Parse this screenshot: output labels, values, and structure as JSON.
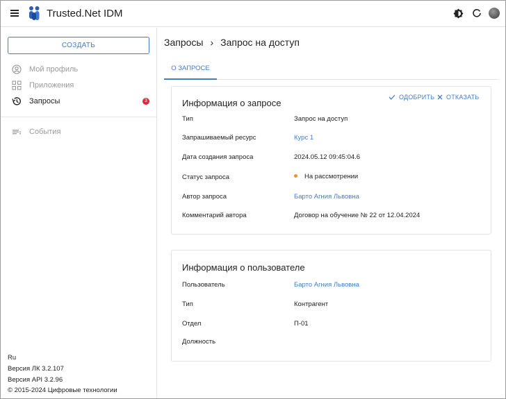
{
  "header": {
    "app_title": "Trusted.Net IDM"
  },
  "sidebar": {
    "create_label": "СОЗДАТЬ",
    "items": [
      {
        "label": "Мой профиль",
        "icon": "account-circle-icon"
      },
      {
        "label": "Приложения",
        "icon": "apps-grid-icon"
      },
      {
        "label": "Запросы",
        "icon": "history-icon",
        "badge": "3"
      },
      {
        "label": "События",
        "icon": "events-list-icon"
      }
    ],
    "footer": {
      "lang": "Ru",
      "lk_version": "Версия ЛК 3.2.107",
      "api_version": "Версия API 3.2.96",
      "copyright": "© 2015-2024 Цифровые технологии"
    }
  },
  "breadcrumb": {
    "root": "Запросы",
    "current": "Запрос на доступ"
  },
  "tabs": {
    "about": "О ЗАПРОСЕ"
  },
  "request_card": {
    "title": "Информация о запросе",
    "approve_label": "ОДОБРИТЬ",
    "reject_label": "ОТКАЗАТЬ",
    "rows": [
      {
        "label": "Тип",
        "value": "Запрос на доступ"
      },
      {
        "label": "Запрашиваемый ресурс",
        "value": "Курс 1"
      },
      {
        "label": "Дата создания запроса",
        "value": "2024.05.12 09:45:04.6"
      },
      {
        "label": "Статус запроса",
        "value": "На рассмотрении"
      },
      {
        "label": "Автор запроса",
        "value": "Барто Агния Львовна"
      },
      {
        "label": "Комментарий автора",
        "value": "Договор на обучение № 22 от 12.04.2024"
      }
    ]
  },
  "user_card": {
    "title": "Информация о пользователе",
    "rows": [
      {
        "label": "Пользователь",
        "value": "Барто Агния Львовна"
      },
      {
        "label": "Тип",
        "value": "Контрагент"
      },
      {
        "label": "Отдел",
        "value": "П-01"
      },
      {
        "label": "Должность",
        "value": ""
      }
    ]
  },
  "colors": {
    "accent": "#3f7fc8",
    "badge": "#e0263e",
    "status_pending": "#f0922f"
  }
}
